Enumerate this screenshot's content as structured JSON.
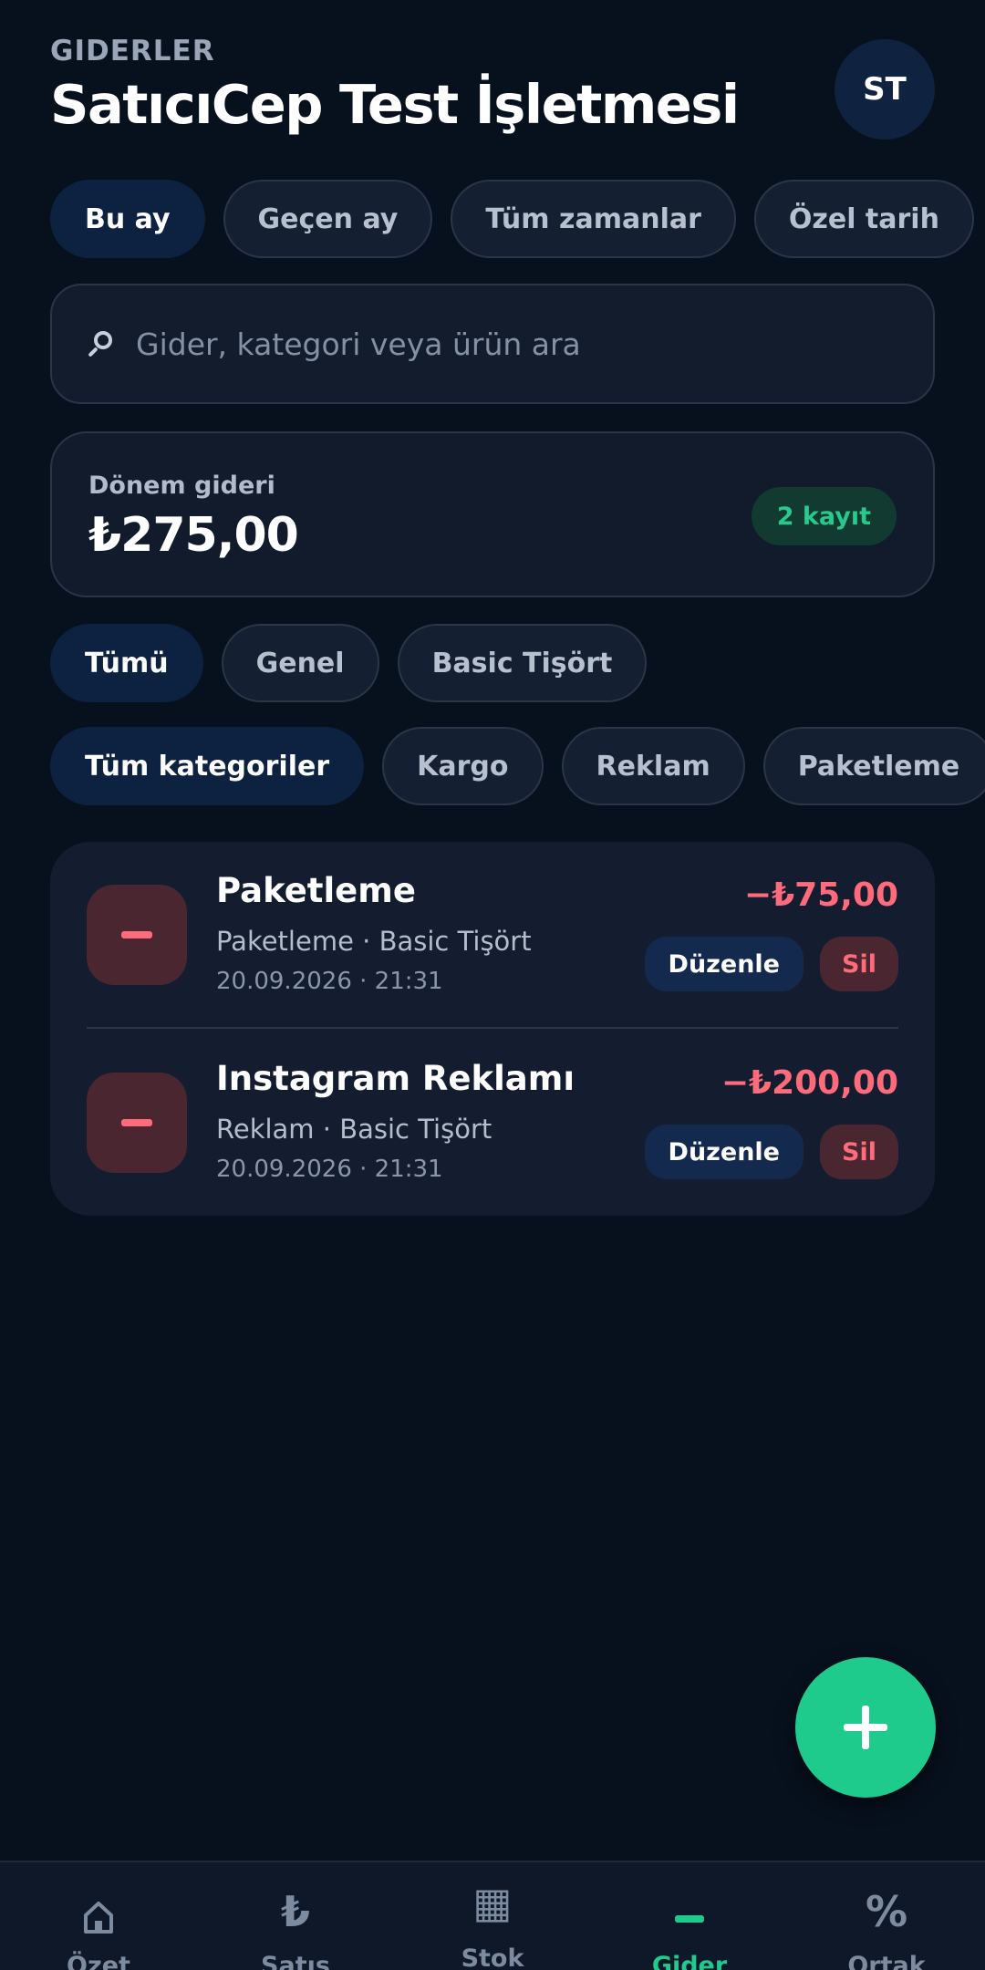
{
  "header": {
    "eyebrow": "GIDERLER",
    "title": "SatıcıCep Test İşletmesi",
    "avatar": "ST"
  },
  "period_filters": [
    {
      "label": "Bu ay",
      "active": true
    },
    {
      "label": "Geçen ay",
      "active": false
    },
    {
      "label": "Tüm zamanlar",
      "active": false
    },
    {
      "label": "Özel tarih",
      "active": false
    }
  ],
  "search": {
    "value": "",
    "placeholder": "Gider, kategori veya ürün ara"
  },
  "summary": {
    "label": "Dönem gideri",
    "amount": "₺275,00",
    "badge": "2 kayıt"
  },
  "scope_filters": [
    {
      "label": "Tümü",
      "active": true
    },
    {
      "label": "Genel",
      "active": false
    },
    {
      "label": "Basic Tişört",
      "active": false
    }
  ],
  "category_filters": [
    {
      "label": "Tüm kategoriler",
      "active": true
    },
    {
      "label": "Kargo",
      "active": false
    },
    {
      "label": "Reklam",
      "active": false
    },
    {
      "label": "Paketleme",
      "active": false
    }
  ],
  "expenses": [
    {
      "title": "Paketleme",
      "subtitle": "Paketleme · Basic Tişört",
      "date": "20.09.2026 · 21:31",
      "amount": "−₺75,00",
      "edit_label": "Düzenle",
      "delete_label": "Sil"
    },
    {
      "title": "Instagram Reklamı",
      "subtitle": "Reklam · Basic Tişört",
      "date": "20.09.2026 · 21:31",
      "amount": "−₺200,00",
      "edit_label": "Düzenle",
      "delete_label": "Sil"
    }
  ],
  "fab": {
    "icon": "plus-icon"
  },
  "bottom_nav": [
    {
      "label": "Özet",
      "icon": "home-icon",
      "active": false
    },
    {
      "label": "Satış",
      "icon": "lira-icon",
      "glyph": "₺",
      "active": false
    },
    {
      "label": "Stok",
      "icon": "grid-icon",
      "glyph": "▦",
      "active": false
    },
    {
      "label": "Gider",
      "icon": "minus-icon",
      "active": true
    },
    {
      "label": "Ortak",
      "icon": "percent-icon",
      "glyph": "%",
      "active": false
    }
  ],
  "colors": {
    "background": "#07101d",
    "accent_green": "#1fcb8c",
    "expense_red": "#ff6b7a",
    "active_chip": "#0d2140"
  }
}
